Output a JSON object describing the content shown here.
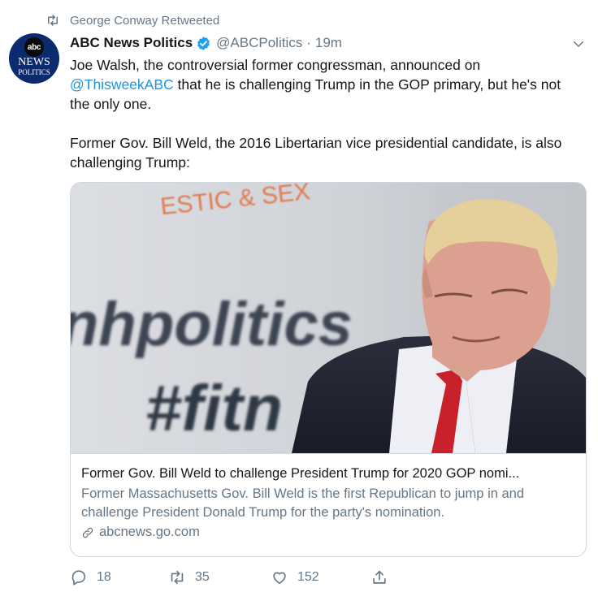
{
  "retweet_context": {
    "text": "George Conway Retweeted",
    "icon": "retweet-icon"
  },
  "author": {
    "name": "ABC News Politics",
    "handle": "@ABCPolitics",
    "separator": "·",
    "time": "19m",
    "verified": true,
    "avatar": {
      "logo": "abc",
      "line1": "NEWS",
      "line2": "POLITICS"
    }
  },
  "tweet": {
    "paragraph1_start": "Joe Walsh, the controversial former congressman, announced on ",
    "mention": "@ThisweekABC",
    "paragraph1_end": " that he is challenging Trump in the GOP primary, but he's not the only one.",
    "paragraph2": "Former Gov. Bill Weld, the 2016 Libertarian vice presidential candidate, is also challenging Trump:"
  },
  "card": {
    "image_text_top": "ESTIC & SEX",
    "image_text_mid": "nhpolitics",
    "image_text_bottom": "#fitn",
    "title": "Former Gov. Bill Weld to challenge President Trump for 2020 GOP nomi...",
    "description": "Former Massachusetts Gov. Bill Weld is the first Republican to jump in and challenge President Donald Trump for the party's nomination.",
    "domain": "abcnews.go.com"
  },
  "actions": {
    "reply_count": "18",
    "retweet_count": "35",
    "like_count": "152"
  },
  "colors": {
    "link": "#1b95e0",
    "secondary_text": "#657786",
    "verified_badge": "#1da1f2",
    "avatar_bg": "#0c2a6e",
    "border": "#ccd6dd"
  }
}
